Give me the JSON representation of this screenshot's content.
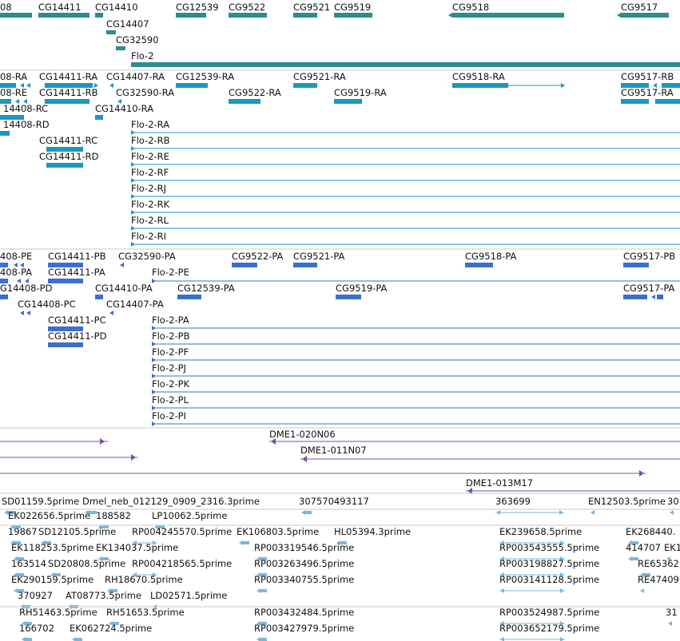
{
  "colors": {
    "gene": "#2c8c90",
    "transcript": "#1a97c0",
    "protein": "#3a6fd0",
    "clone": "#7a4fa4",
    "est": "#7ab7dc",
    "divider": "#c8c8c8",
    "label": "#111111"
  },
  "tracks": [
    {
      "name": "genes",
      "items": [
        "08",
        "CG14411",
        "CG14410",
        "CG14407",
        "CG32590",
        "CG12539",
        "CG9522",
        "CG9521",
        "CG9519",
        "CG9518",
        "CG9517",
        "Flo-2"
      ]
    },
    {
      "name": "transcripts",
      "items": [
        "08-RA",
        "CG14411-RA",
        "CG14407-RA",
        "CG12539-RA",
        "CG9521-RA",
        "CG9518-RA",
        "CG9517-RB",
        "08-RE",
        "CG14411-RB",
        "CG32590-RA",
        "CG9522-RA",
        "CG9519-RA",
        "CG9517-RA",
        "14408-RC",
        "CG14410-RA",
        "14408-RD",
        "Flo-2-RA",
        "CG14411-RC",
        "Flo-2-RB",
        "CG14411-RD",
        "Flo-2-RE",
        "Flo-2-RF",
        "Flo-2-RJ",
        "Flo-2-RK",
        "Flo-2-RL",
        "Flo-2-RI"
      ]
    },
    {
      "name": "proteins",
      "items": [
        "408-PE",
        "CG14411-PB",
        "CG32590-PA",
        "CG9522-PA",
        "CG9521-PA",
        "CG9518-PA",
        "CG9517-PB",
        "408-PA",
        "CG14411-PA",
        "Flo-2-PE",
        "G14408-PD",
        "CG14410-PA",
        "CG12539-PA",
        "CG9519-PA",
        "CG9517-PA",
        "CG14408-PC",
        "CG14407-PA",
        "CG14411-PC",
        "Flo-2-PA",
        "CG14411-PD",
        "Flo-2-PB",
        "Flo-2-PF",
        "Flo-2-PJ",
        "Flo-2-PK",
        "Flo-2-PL",
        "Flo-2-PI"
      ]
    },
    {
      "name": "clones",
      "items": [
        "DME1-020N06",
        "DME1-011N07",
        "DME1-013M17"
      ]
    },
    {
      "name": "ests",
      "items": [
        "SD01159.5prime",
        "Dmel_neb_012129_0909_2316.3prime",
        "307570493117",
        "363699",
        "EN12503.5prime",
        "30",
        "EK022656.5prime",
        "188582",
        "LP10062.5prime",
        "19867",
        "SD12105.5prime",
        "RP004245570.5prime",
        "EK106803.5prime",
        "HL05394.3prime",
        "EK239658.5prime",
        "EK268440.",
        "EK118253.5prime",
        "EK134037.5prime",
        "RP003319546.5prime",
        "RP003543555.5prime",
        "414707",
        "EK1",
        "163514",
        "SD20808.5prime",
        "RP004218565.5prime",
        "RP003263496.5prime",
        "RP003198827.5prime",
        "RE65362",
        "EK290159.5prime",
        "RH18670.5prime",
        "RP003340755.5prime",
        "RP003141128.5prime",
        "RE47409",
        "370927",
        "AT08773.5prime",
        "LD02571.5prime",
        "RH51463.5prime",
        "RH51653.5prime",
        "RP003432484.5prime",
        "RP003524987.5prime",
        "31",
        "166702",
        "EK062724.5prime",
        "RP003427979.5prime",
        "RP003652179.5prime"
      ]
    }
  ]
}
